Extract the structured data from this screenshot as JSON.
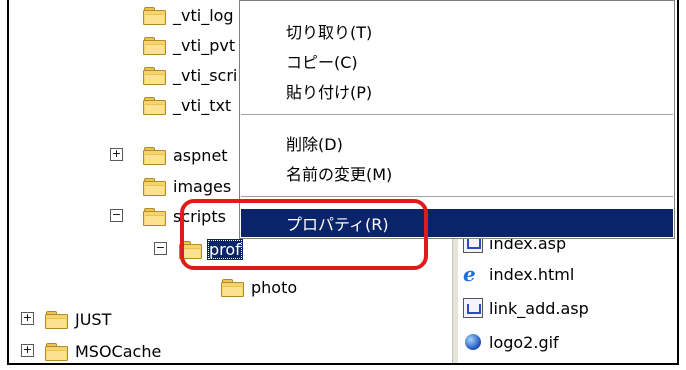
{
  "tree": [
    {
      "id": "vti-log",
      "label": "_vti_log"
    },
    {
      "id": "vti-pvt",
      "label": "_vti_pvt"
    },
    {
      "id": "vti-scr",
      "label": "_vti_scri"
    },
    {
      "id": "vti-txt",
      "label": "_vti_txt"
    },
    {
      "id": "aspnet",
      "label": "aspnet"
    },
    {
      "id": "images",
      "label": "images"
    },
    {
      "id": "scripts",
      "label": "scripts"
    },
    {
      "id": "prof",
      "label": "prof"
    },
    {
      "id": "photo",
      "label": "photo"
    },
    {
      "id": "just",
      "label": "JUST"
    },
    {
      "id": "msocache",
      "label": "MSOCache"
    }
  ],
  "files": [
    {
      "label": "index.asp",
      "icon": "asp-doc-icon"
    },
    {
      "label": "index.html",
      "icon": "ie-html-icon"
    },
    {
      "label": "link_add.asp",
      "icon": "asp-doc-icon"
    },
    {
      "label": "logo2.gif",
      "icon": "gif-image-icon"
    }
  ],
  "context_menu": {
    "cut": "切り取り(T)",
    "copy": "コピー(C)",
    "paste": "貼り付け(P)",
    "delete": "削除(D)",
    "rename": "名前の変更(M)",
    "properties": "プロパティ(R)"
  },
  "expanders": {
    "plus": "+",
    "minus": "−"
  },
  "colors": {
    "selection": "#0a246a",
    "callout": "#e01b1b",
    "folder": "#f6d36b"
  }
}
